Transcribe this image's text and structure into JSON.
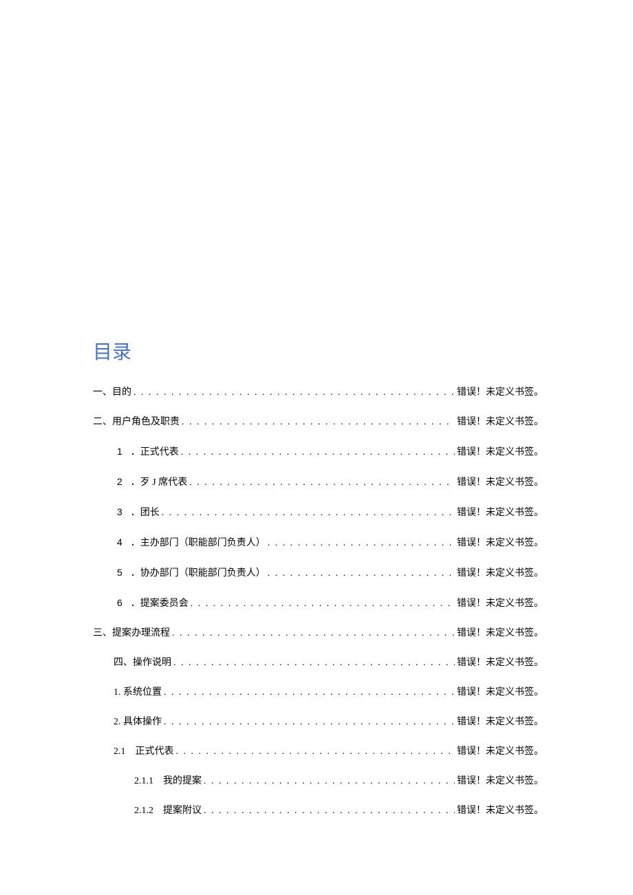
{
  "title": "目录",
  "errorText": "错误！未定义书签。",
  "leader": ". . . . . . . . . . . . . . . . . . . . . . . . . . . . . . . . . . . . . . . . . . . . . . . . . . . . . . . . . . . . . . . . . . . . . . . . . . . . . . . . . . . . . . . . . . . . . . . . . . . . . . . . . . . . . . . .",
  "entries": [
    {
      "level": 0,
      "num": "",
      "label": "一、目的",
      "page": "错误！未定义书签。"
    },
    {
      "level": 0,
      "num": "",
      "label": "二、用户角色及职责",
      "page": "错误！未定义书签。"
    },
    {
      "level": 1,
      "num": "1",
      "label": "．正式代表",
      "page": "错误！未定义书签。"
    },
    {
      "level": 1,
      "num": "2",
      "label": "．歹 J 席代表",
      "page": "错误！未定义书签。"
    },
    {
      "level": 1,
      "num": "3",
      "label": "．团长",
      "page": "错误！未定义书签。"
    },
    {
      "level": 1,
      "num": "4",
      "label": "．主办部门（职能部门负责人）",
      "page": "错误！未定义书签。"
    },
    {
      "level": 1,
      "num": "5",
      "label": "．协办部门（职能部门负责人）",
      "page": "错误！未定义书签。"
    },
    {
      "level": 1,
      "num": "6",
      "label": "．提案委员会",
      "page": "错误！未定义书签。"
    },
    {
      "level": 0,
      "num": "",
      "label": "三、提案办理流程",
      "page": "错误！未定义书签。"
    },
    {
      "level": "1b",
      "num": "",
      "label": "四、操作说明",
      "page": "错误！未定义书签。"
    },
    {
      "level": "1b",
      "num": "",
      "label": "1. 系统位置",
      "page": "错误！未定义书签。"
    },
    {
      "level": "1b",
      "num": "",
      "label": "2. 具体操作",
      "page": "错误！未定义书签。"
    },
    {
      "level": "1b",
      "num": "",
      "label": "2.1　正式代表",
      "page": "错误！未定义书签。"
    },
    {
      "level": 2,
      "num": "",
      "label": "2.1.1　我的提案",
      "page": "错误！未定义书签。"
    },
    {
      "level": 2,
      "num": "",
      "label": "2.1.2　提案附议",
      "page": "错误！未定义书签。"
    }
  ]
}
